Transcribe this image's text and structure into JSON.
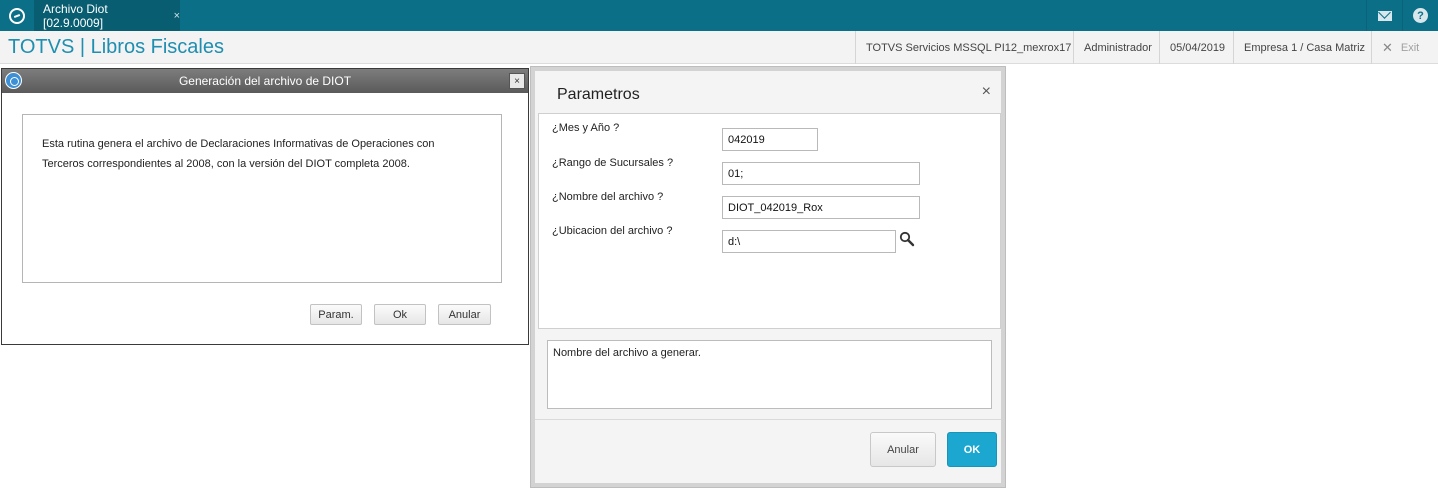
{
  "tab": {
    "title": "Archivo Diot [02.9.0009]",
    "close_symbol": "×"
  },
  "header": {
    "app_title": "TOTVS | Libros Fiscales",
    "environment": "TOTVS Servicios MSSQL PI12_mexrox17",
    "user": "Administrador",
    "date": "05/04/2019",
    "company": "Empresa 1 / Casa Matriz",
    "exit_label": "Exit",
    "exit_symbol": "✕"
  },
  "icons": {
    "mail": "mail-icon",
    "help": "help-icon",
    "help_glyph": "?",
    "search": "search-icon",
    "logo": "totvs-logo-icon"
  },
  "dialog1": {
    "title": "Generación del archivo de DIOT",
    "close_symbol": "×",
    "description_line1": "Esta rutina genera el archivo de Declaraciones Informativas de Operaciones con",
    "description_line2": "Terceros correspondientes al 2008, con la versión del DIOT completa 2008.",
    "buttons": {
      "param": "Param.",
      "ok": "Ok",
      "cancel": "Anular"
    }
  },
  "dialog2": {
    "title": "Parametros",
    "close_symbol": "×",
    "fields": [
      {
        "label": "¿Mes y Año ?",
        "value": "042019"
      },
      {
        "label": "¿Rango de Sucursales ?",
        "value": "01;"
      },
      {
        "label": "¿Nombre del archivo ?",
        "value": "DIOT_042019_Rox"
      },
      {
        "label": "¿Ubicacion del archivo ?",
        "value": "d:\\"
      }
    ],
    "help_text": "Nombre del archivo a generar.",
    "buttons": {
      "cancel": "Anular",
      "ok": "OK"
    }
  },
  "colors": {
    "topbar": "#0b6f87",
    "title_blue": "#1f8eb0",
    "ok_button": "#1ba7cf"
  }
}
